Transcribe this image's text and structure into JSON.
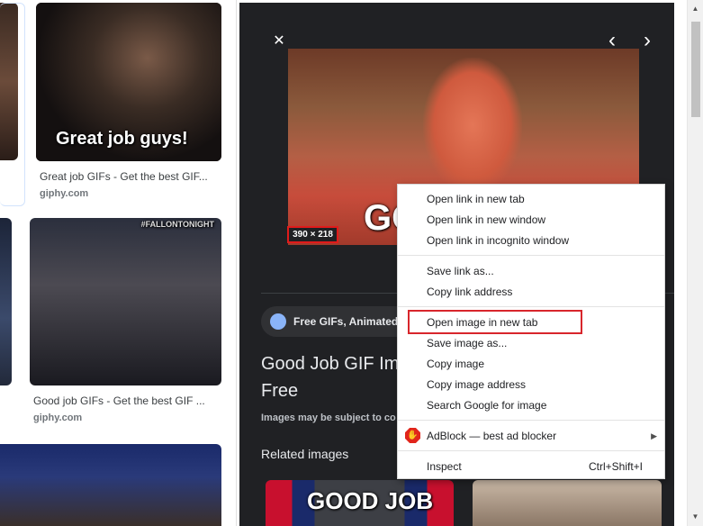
{
  "results": [
    {
      "title": "Great job GIFs - Get the best GIF...",
      "source": "giphy.com",
      "overlay": "Great job guys!"
    },
    {
      "title": "Good job GIFs - Get the best GIF ...",
      "source": "giphy.com",
      "overlay": "#FALLONTONIGHT"
    },
    {
      "title": "",
      "source": "",
      "overlay": ""
    }
  ],
  "preview": {
    "image_dimensions": "390 × 218",
    "image_overlay": "GO",
    "chip_label": "Free GIFs, Animated",
    "title_line1": "Good Job GIF Im",
    "title_line2": "Free",
    "note": "Images may be subject to co",
    "related_label": "Related images",
    "related_overlay": "GOOD JOB",
    "close_glyph": "✕",
    "prev_glyph": "‹",
    "next_glyph": "›"
  },
  "context_menu": {
    "items": [
      {
        "label": "Open link in new tab"
      },
      {
        "label": "Open link in new window"
      },
      {
        "label": "Open link in incognito window"
      },
      {
        "label": "Save link as..."
      },
      {
        "label": "Copy link address"
      },
      {
        "label": "Open image in new tab"
      },
      {
        "label": "Save image as..."
      },
      {
        "label": "Copy image"
      },
      {
        "label": "Copy image address"
      },
      {
        "label": "Search Google for image"
      },
      {
        "label": "AdBlock — best ad blocker"
      },
      {
        "label": "Inspect",
        "shortcut": "Ctrl+Shift+I"
      }
    ],
    "highlight_color": "#d8262c"
  },
  "icons": {
    "adblock": "adblock-hand-icon",
    "chip": "globe-icon"
  },
  "colors": {
    "preview_bg": "#202124",
    "highlight": "#e01b1b"
  }
}
